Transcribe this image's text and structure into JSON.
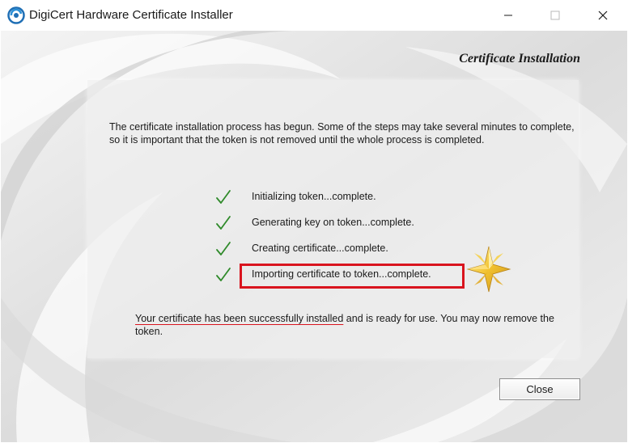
{
  "window": {
    "title": "DigiCert Hardware Certificate Installer",
    "controls": [
      "minimize-icon",
      "maximize-icon",
      "close-icon"
    ]
  },
  "header": {
    "title": "Certificate Installation"
  },
  "intro_text": "The certificate installation process has begun.  Some of the steps may take several minutes to complete, so it is important that the token is not removed until the whole process is completed.",
  "steps": [
    {
      "label": "Initializing token...complete.",
      "icon": "checkmark-icon"
    },
    {
      "label": "Generating key on token...complete.",
      "icon": "checkmark-icon"
    },
    {
      "label": "Creating certificate...complete.",
      "icon": "checkmark-icon"
    },
    {
      "label": "Importing certificate to token...complete.",
      "icon": "checkmark-icon"
    }
  ],
  "success": {
    "underlined": "Your certificate has been successfully installed",
    "rest": " and is ready for use.  You may now remove the token."
  },
  "buttons": {
    "close_label": "Close"
  },
  "colors": {
    "check": "#2f8a2a",
    "highlight": "#d9141e",
    "star": "#f2c230"
  }
}
